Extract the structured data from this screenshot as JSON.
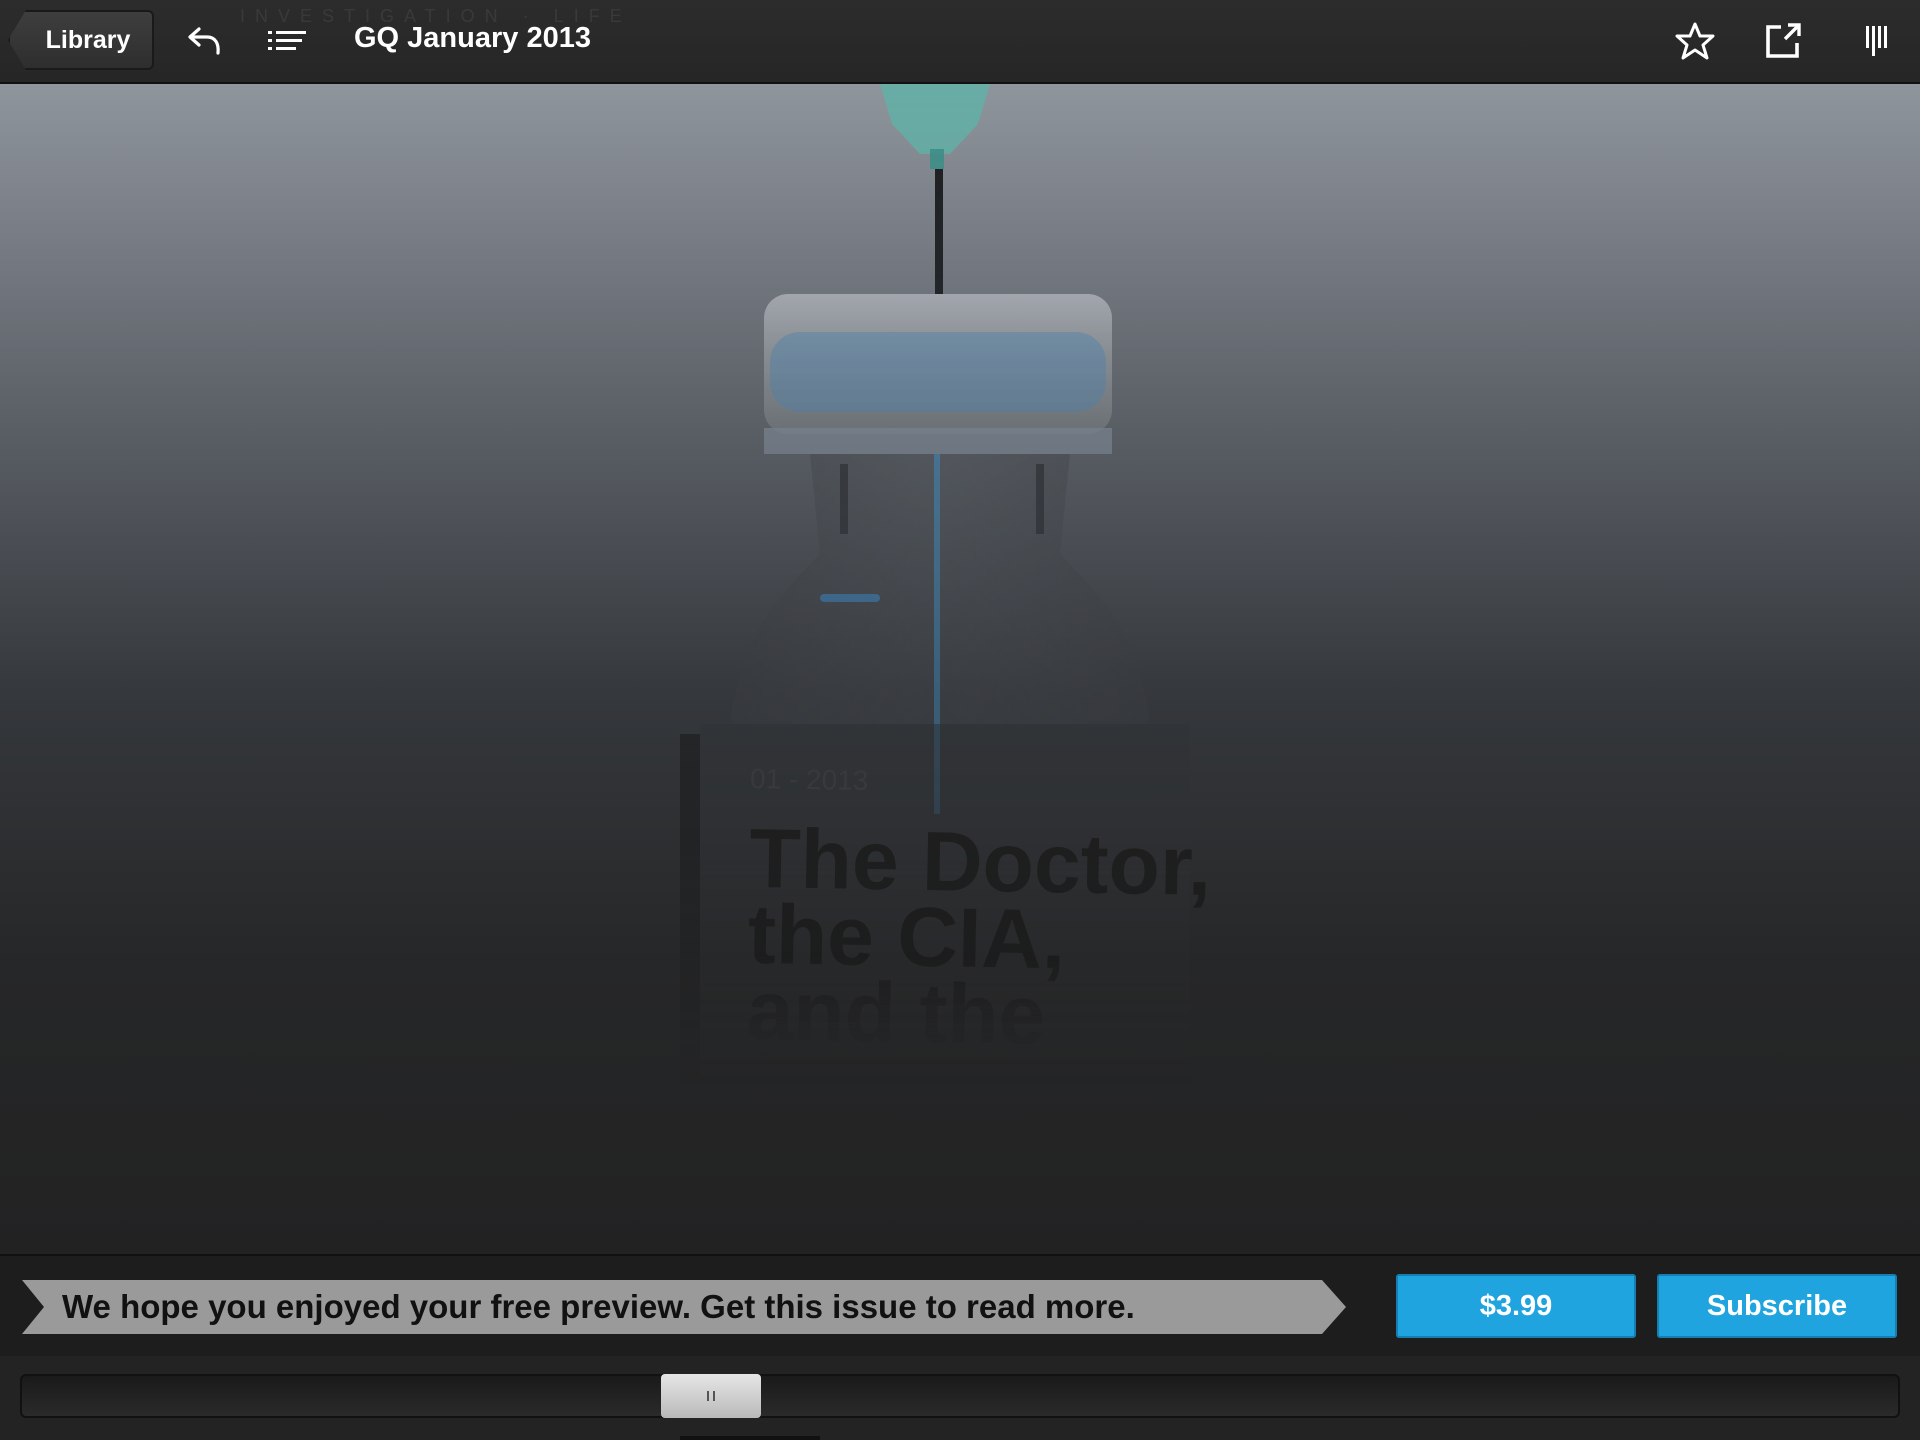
{
  "toolbar": {
    "library_label": "Library",
    "title": "GQ January 2013",
    "ghost_header": "INVESTIGATION · LIFE",
    "icons": [
      "back-arrow-icon",
      "contents-list-icon",
      "star-icon",
      "share-icon",
      "page-view-icon"
    ]
  },
  "cover": {
    "date": "01 - 2013",
    "headline_lines": [
      "The Doctor,",
      "the CIA,",
      "and the"
    ]
  },
  "promo": {
    "message": "We hope you enjoyed your free preview. Get this issue to read more.",
    "price_label": "$3.99",
    "subscribe_label": "Subscribe",
    "button_color": "#1fa4e0"
  },
  "scrubber": {
    "position_fraction": 0.36
  }
}
